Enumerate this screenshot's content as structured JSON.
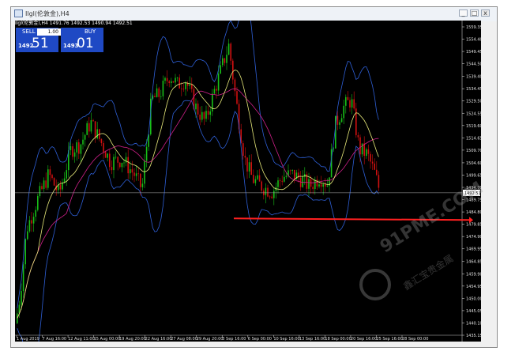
{
  "window": {
    "title": "Ilgl(伦敦金),H4",
    "buttons": [
      "_",
      "□",
      "x"
    ]
  },
  "trade_panel": {
    "header": "Ilgl(伦敦金),H4  1491.76 1492.53 1490.94 1492.51",
    "sell_label": "SELL",
    "buy_label": "BUY",
    "lot": "1.00",
    "sell_price_prefix": "1492",
    "sell_price_big": "51",
    "buy_price_prefix": "1493",
    "buy_price_big": "01",
    "color": "#1f49c4"
  },
  "chart": {
    "price_labels": [
      "1559.35",
      "1554.40",
      "1549.45",
      "1544.50",
      "1539.40",
      "1534.45",
      "1529.50",
      "1524.55",
      "1519.60",
      "1514.65",
      "1509.70",
      "1504.60",
      "1499.65",
      "1494.70",
      "1489.75",
      "1484.80",
      "1479.85",
      "1474.90",
      "1469.95",
      "1464.85",
      "1459.90",
      "1454.95",
      "1450.00",
      "1445.05",
      "1440.10",
      "1435.15"
    ],
    "current_price": "1492.51",
    "time_labels": [
      "1 Aug 2019",
      "7 Aug 16:00",
      "12 Aug 11:00",
      "15 Aug 00:00",
      "19 Aug 20:00",
      "22 Aug 16:00",
      "27 Aug 08:00",
      "29 Aug 20:00",
      "3 Sep 16:00",
      "6 Sep 00:00",
      "10 Sep 16:00",
      "13 Sep 16:00",
      "18 Sep 00:00",
      "20 Sep 16:00",
      "25 Sep 16:00",
      "28 Sep 00:00"
    ],
    "bull_color": "#18c018",
    "bear_color": "#d01010",
    "band_color": "#2e5fd6",
    "ma_fast_color": "#e8ea7a",
    "ma_slow_color": "#d0208a",
    "support_color": "#ff2020"
  },
  "watermark": {
    "text": "91PME.COM",
    "subtext": "鑫汇宝贵金属"
  }
}
